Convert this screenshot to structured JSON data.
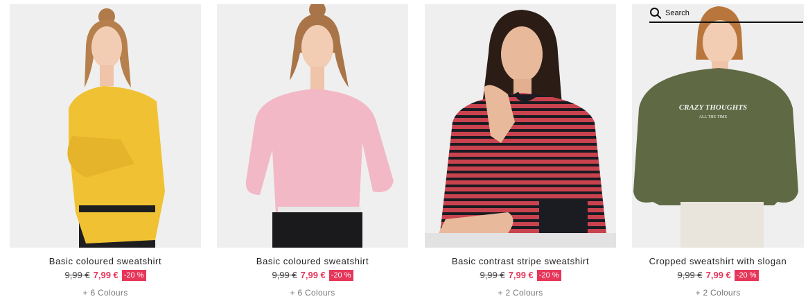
{
  "search": {
    "placeholder": "Search"
  },
  "products": [
    {
      "name": "Basic coloured sweatshirt",
      "old_price": "9,99 €",
      "new_price": "7,99 €",
      "discount": "-20 %",
      "colours": "+ 6 Colours",
      "sweater_color": "#f0c233",
      "image": "woman-yellow-sweatshirt"
    },
    {
      "name": "Basic coloured sweatshirt",
      "old_price": "9,99 €",
      "new_price": "7,99 €",
      "discount": "-20 %",
      "colours": "+ 6 Colours",
      "sweater_color": "#f2b8c6",
      "image": "woman-pink-sweatshirt"
    },
    {
      "name": "Basic contrast stripe sweatshirt",
      "old_price": "9,99 €",
      "new_price": "7,99 €",
      "discount": "-20 %",
      "colours": "+ 2 Colours",
      "sweater_color": "#c9434f",
      "image": "woman-striped-sweatshirt"
    },
    {
      "name": "Cropped sweatshirt with slogan",
      "old_price": "9,99 €",
      "new_price": "7,99 €",
      "discount": "-20 %",
      "colours": "+ 2 Colours",
      "sweater_color": "#5f6a44",
      "image": "woman-khaki-slogan-sweatshirt",
      "slogan_line1": "CRAZY THOUGHTS",
      "slogan_line2": "ALL THE TIME"
    }
  ],
  "colors": {
    "sale": "#e6375a",
    "background": "#ffffff",
    "photo_bg": "#efefef"
  }
}
